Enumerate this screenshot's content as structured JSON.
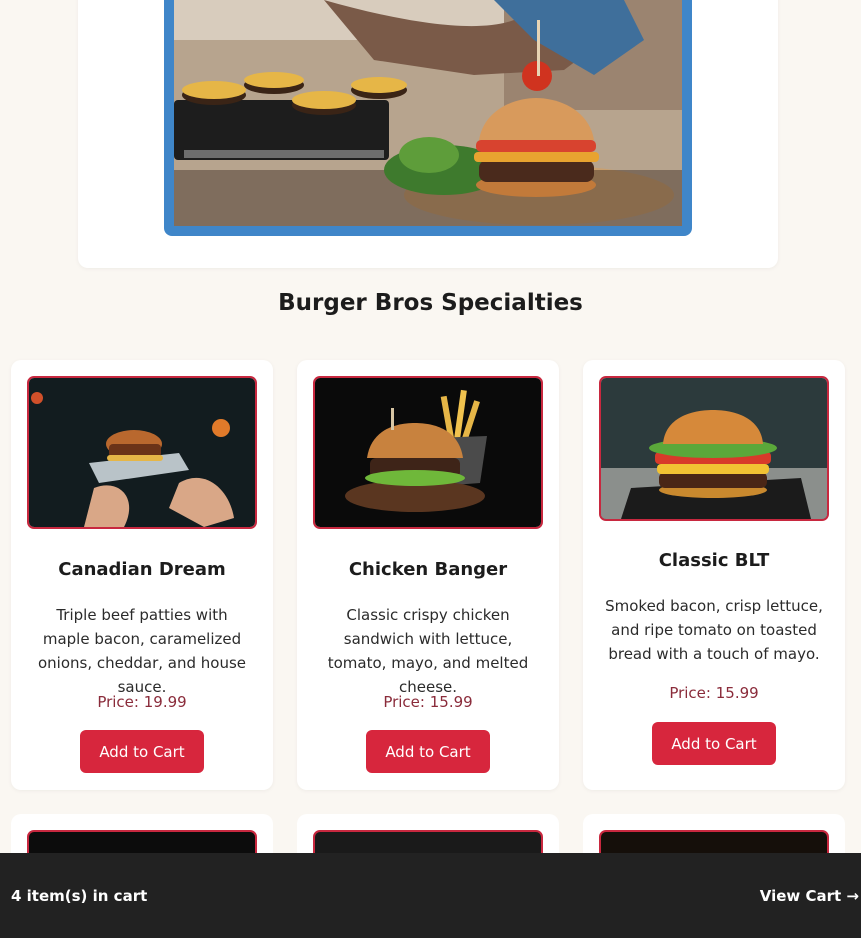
{
  "hero": {
    "image_alt": "Chef placing a cherry tomato on a burger"
  },
  "section_title": "Burger Bros Specialties",
  "products": [
    {
      "name": "Canadian Dream",
      "description": "Triple beef patties with maple bacon, caramelized onions, cheddar, and house sauce.",
      "price": "Price: 19.99",
      "button": "Add to Cart"
    },
    {
      "name": "Chicken Banger",
      "description": "Classic crispy chicken sandwich with lettuce, tomato, mayo, and melted cheese.",
      "price": "Price: 15.99",
      "button": "Add to Cart"
    },
    {
      "name": "Classic BLT",
      "description": "Smoked bacon, crisp lettuce, and ripe tomato on toasted bread with a touch of mayo.",
      "price": "Price: 15.99",
      "button": "Add to Cart"
    }
  ],
  "cart_bar": {
    "count_text": "4 item(s) in cart",
    "view_cart": "View Cart →"
  },
  "colors": {
    "accent": "#d7263d",
    "price": "#8a2b3a",
    "hero_border": "#3f86c9",
    "cart_bar": "#222222",
    "background": "#faf7f2"
  }
}
